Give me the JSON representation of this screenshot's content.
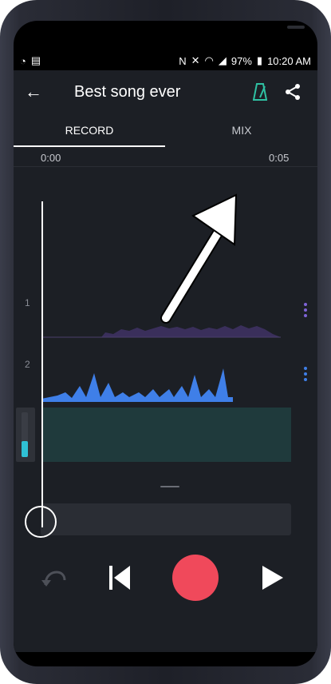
{
  "status": {
    "battery": "97%",
    "time": "10:20 AM"
  },
  "toolbar": {
    "title": "Best song ever"
  },
  "tabs": [
    {
      "label": "RECORD",
      "selected": true
    },
    {
      "label": "MIX",
      "selected": false
    }
  ],
  "timeline": {
    "start_label": "0:00",
    "end_label": "0:05"
  },
  "tracks": [
    {
      "label": "1",
      "color": "#3a2f5b"
    },
    {
      "label": "2",
      "color": "#3f7fe8"
    }
  ],
  "input_level": 0.35,
  "colors": {
    "accent": "#2fc1d5",
    "record": "#f0495b",
    "menu_dots": "#7e63d6"
  },
  "icons": {
    "back": "arrow-left-icon",
    "metronome": "metronome-icon",
    "share": "share-icon",
    "undo": "undo-icon",
    "prev": "skip-previous-icon",
    "play": "play-icon"
  }
}
